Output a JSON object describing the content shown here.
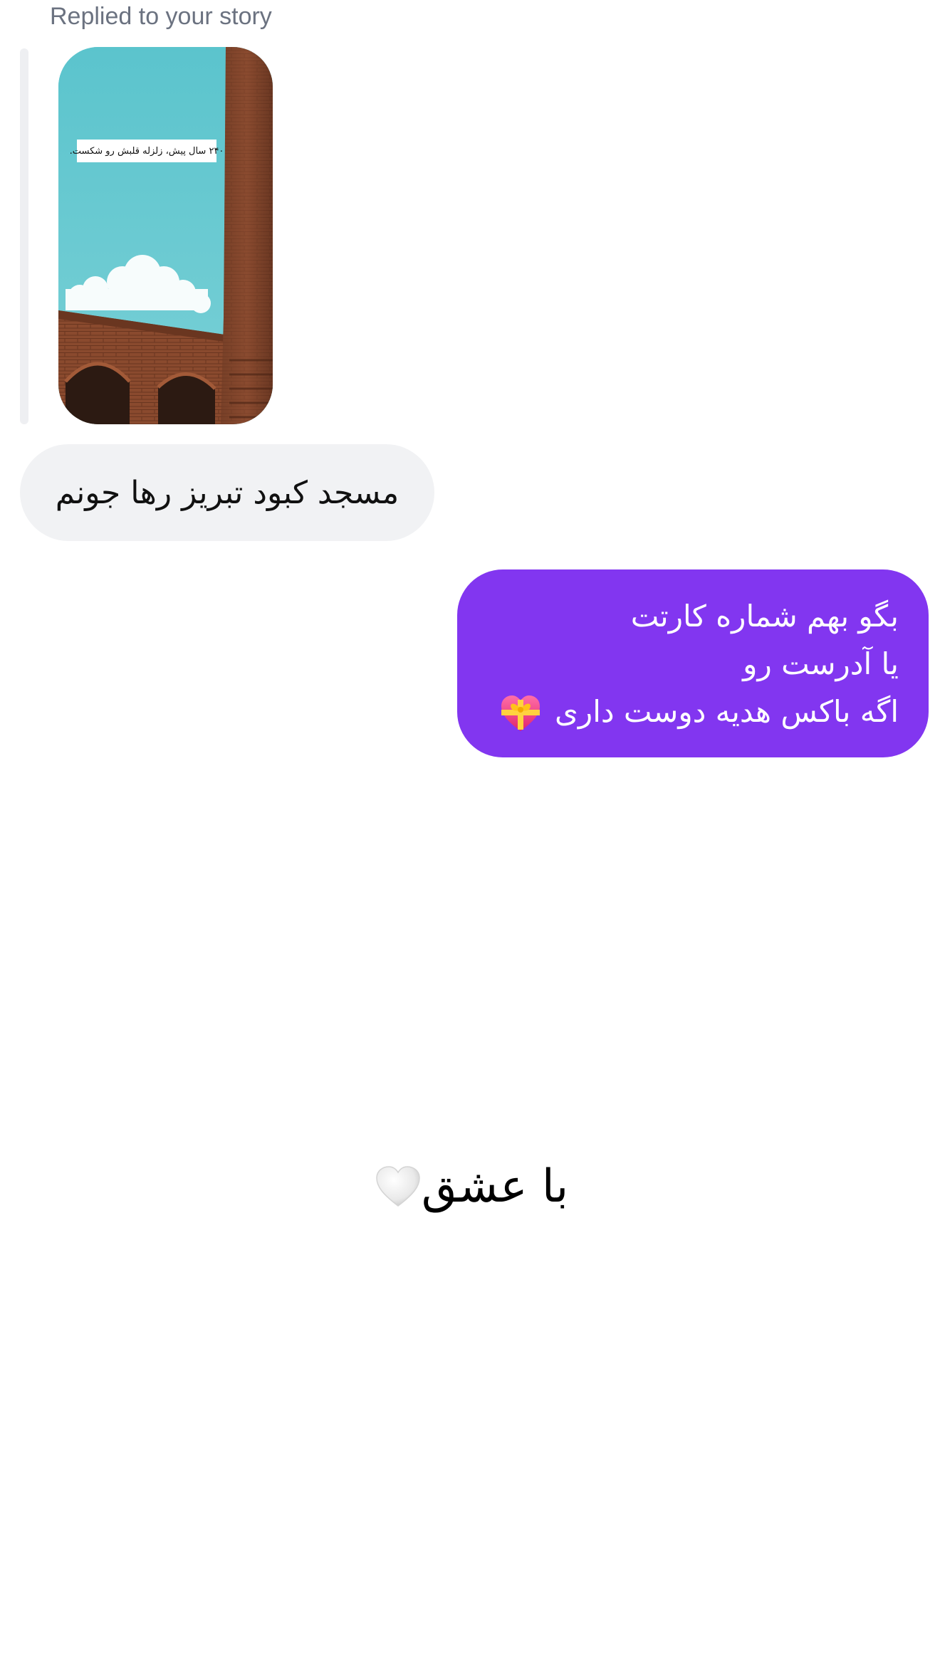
{
  "reply_header": {
    "label": "Replied to your story"
  },
  "story": {
    "caption": "۲۴۰ سال پیش، زلزله قلبش رو شکست."
  },
  "messages": {
    "received": {
      "text": "مسجد کبود تبریز رها جونم"
    },
    "sent": {
      "lines": [
        "بگو بهم شماره کارتت",
        "یا آدرست رو",
        "اگه باکس هدیه دوست داری"
      ],
      "emoji": "heart-with-ribbon-icon"
    }
  },
  "footer": {
    "text": "با عشق",
    "emoji": "white-heart-icon"
  },
  "colors": {
    "sent_bubble": "#8236f0",
    "received_bubble": "#f1f2f4",
    "reply_bar": "#eeeff2",
    "muted_text": "#6b7280"
  }
}
